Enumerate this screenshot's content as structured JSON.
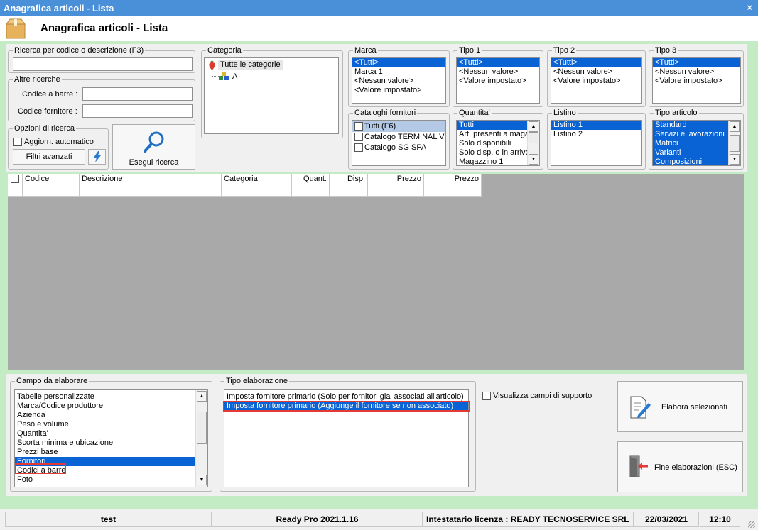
{
  "window": {
    "title": "Anagrafica articoli  - Lista",
    "close": "×"
  },
  "header": {
    "title": "Anagrafica articoli  - Lista"
  },
  "search": {
    "group_label": "Ricerca per codice o descrizione (F3)",
    "value": ""
  },
  "other": {
    "group_label": "Altre ricerche",
    "barcode_label": "Codice a barre :",
    "supplier_label": "Codice fornitore :"
  },
  "options": {
    "group_label": "Opzioni di ricerca",
    "auto_update_label": "Aggiorn. automatico",
    "advanced_filters_label": "Filtri avanzati"
  },
  "execute": {
    "label": "Esegui ricerca"
  },
  "categoria": {
    "label": "Categoria",
    "root": "Tutte le categorie",
    "child": "A"
  },
  "marca": {
    "label": "Marca",
    "items": [
      "<Tutti>",
      "Marca 1",
      "<Nessun valore>",
      "<Valore impostato>"
    ]
  },
  "tipo1": {
    "label": "Tipo 1",
    "items": [
      "<Tutti>",
      "<Nessun valore>",
      "<Valore impostato>"
    ]
  },
  "tipo2": {
    "label": "Tipo 2",
    "items": [
      "<Tutti>",
      "<Nessun valore>",
      "<Valore impostato>"
    ]
  },
  "tipo3": {
    "label": "Tipo 3",
    "items": [
      "<Tutti>",
      "<Nessun valore>",
      "<Valore impostato>"
    ]
  },
  "cataloghi": {
    "label": "Cataloghi fornitori",
    "items": [
      "Tutti (F6)",
      "Catalogo TERMINAL VID",
      "Catalogo SG SPA"
    ]
  },
  "quantita": {
    "label": "Quantita'",
    "items": [
      "Tutti",
      "Art. presenti a magaz",
      "Solo disponibili",
      "Solo disp. o in arrivo",
      "Magazzino 1"
    ]
  },
  "listino": {
    "label": "Listino",
    "items": [
      "Listino 1",
      "Listino 2"
    ]
  },
  "tipo_articolo": {
    "label": "Tipo articolo",
    "items": [
      "Standard",
      "Servizi e lavorazioni",
      "Matrici",
      "Varianti",
      "Composizioni"
    ]
  },
  "grid": {
    "columns": [
      "Codice",
      "Descrizione",
      "Categoria",
      "Quant.",
      "Disp.",
      "Prezzo",
      "Prezzo"
    ]
  },
  "campo": {
    "label": "Campo da elaborare",
    "items": [
      "Tabelle personalizzate",
      "Marca/Codice produttore",
      "Azienda",
      "Peso e volume",
      "Quantita'",
      "Scorta minima e ubicazione",
      "Prezzi base",
      "Fornitori",
      "Codici a barre",
      "Foto"
    ]
  },
  "tipo_elab": {
    "label": "Tipo elaborazione",
    "items": [
      "Imposta fornitore primario (Solo per fornitori gia' associati all'articolo)",
      "Imposta fornitore primario (Aggiunge il fornitore se non associato)"
    ]
  },
  "support": {
    "label": "Visualizza campi di supporto"
  },
  "actions": {
    "process_label": "Elabora selezionati",
    "end_label": "Fine elaborazioni (ESC)"
  },
  "status": {
    "user": "test",
    "version": "Ready Pro 2021.1.16",
    "license": "Intestatario licenza : READY TECNOSERVICE SRL",
    "date": "22/03/2021",
    "time": "12:10"
  }
}
